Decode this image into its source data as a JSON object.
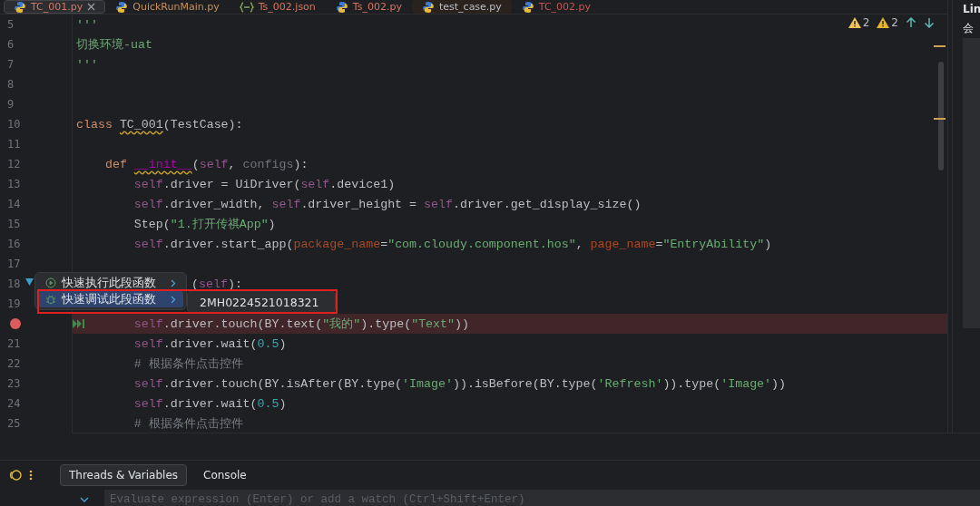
{
  "tabs": [
    {
      "label": "TC_001.py",
      "selected": true,
      "color": "#d5775f",
      "closable": true,
      "kind": "python"
    },
    {
      "label": "QuickRunMain.py",
      "selected": false,
      "color": "#c8905a",
      "closable": false,
      "kind": "python"
    },
    {
      "label": "Ts_002.json",
      "selected": false,
      "color": "#d5775f",
      "closable": false,
      "kind": "json"
    },
    {
      "label": "Ts_002.py",
      "selected": false,
      "color": "#d5775f",
      "closable": false,
      "kind": "python"
    },
    {
      "label": "test_case.py",
      "selected": false,
      "color": "#bcbec4",
      "closable": false,
      "kind": "python"
    },
    {
      "label": "TC_002.py",
      "selected": false,
      "color": "#c75450",
      "closable": false,
      "kind": "python"
    }
  ],
  "inspections": [
    {
      "kind": "warning",
      "count": "2"
    },
    {
      "kind": "weak-warning",
      "count": "2"
    }
  ],
  "lines": [
    {
      "number": "5",
      "breakpoint": false,
      "tokens": [
        {
          "text": "'''",
          "kind": "string"
        }
      ]
    },
    {
      "number": "6",
      "breakpoint": false,
      "tokens": [
        {
          "text": "切换环境-uat",
          "kind": "string"
        }
      ]
    },
    {
      "number": "7",
      "breakpoint": false,
      "tokens": [
        {
          "text": "'''",
          "kind": "string"
        }
      ]
    },
    {
      "number": "8",
      "breakpoint": false
    },
    {
      "number": "9",
      "breakpoint": false
    },
    {
      "number": "10",
      "breakpoint": false,
      "tokens": [
        {
          "text": "class ",
          "kind": "keyword"
        },
        {
          "text": "TC_001",
          "kind": "warned"
        },
        {
          "text": "(TestCase):",
          "kind": "plain"
        }
      ]
    },
    {
      "number": "11",
      "breakpoint": false
    },
    {
      "number": "12",
      "breakpoint": false,
      "tokens": [
        {
          "text": "    def ",
          "kind": "keyword"
        },
        {
          "text": "__init__",
          "kind": "magic"
        },
        {
          "text": "(",
          "kind": "plain"
        },
        {
          "text": "self",
          "kind": "self"
        },
        {
          "text": ", ",
          "kind": "plain"
        },
        {
          "text": "configs",
          "kind": "unused"
        },
        {
          "text": "):",
          "kind": "plain"
        }
      ]
    },
    {
      "number": "13",
      "breakpoint": false,
      "tokens": [
        {
          "text": "        self",
          "kind": "self"
        },
        {
          "text": ".driver = UiDriver(",
          "kind": "plain"
        },
        {
          "text": "self",
          "kind": "self"
        },
        {
          "text": ".device1)",
          "kind": "plain"
        }
      ]
    },
    {
      "number": "14",
      "breakpoint": false,
      "tokens": [
        {
          "text": "        self",
          "kind": "self"
        },
        {
          "text": ".driver_width, ",
          "kind": "plain"
        },
        {
          "text": "self",
          "kind": "self"
        },
        {
          "text": ".driver_height = ",
          "kind": "plain"
        },
        {
          "text": "self",
          "kind": "self"
        },
        {
          "text": ".driver.get_display_size()",
          "kind": "plain"
        }
      ]
    },
    {
      "number": "15",
      "breakpoint": false,
      "tokens": [
        {
          "text": "        Step(",
          "kind": "plain"
        },
        {
          "text": "\"1.打开传祺App\"",
          "kind": "string"
        },
        {
          "text": ")",
          "kind": "plain"
        }
      ]
    },
    {
      "number": "16",
      "breakpoint": false,
      "tokens": [
        {
          "text": "        self",
          "kind": "self"
        },
        {
          "text": ".driver.start_app(",
          "kind": "plain"
        },
        {
          "text": "package_name",
          "kind": "param"
        },
        {
          "text": "=",
          "kind": "plain"
        },
        {
          "text": "\"com.cloudy.component.hos\"",
          "kind": "string"
        },
        {
          "text": ", ",
          "kind": "plain"
        },
        {
          "text": "page_name",
          "kind": "param"
        },
        {
          "text": "=",
          "kind": "plain"
        },
        {
          "text": "\"EntryAbility\"",
          "kind": "string"
        },
        {
          "text": ")",
          "kind": "plain"
        }
      ]
    },
    {
      "number": "17",
      "breakpoint": false
    },
    {
      "number": "18",
      "breakpoint": false,
      "kind": "covered",
      "gutter_icon": true,
      "tokens": [
        {
          "text": "(",
          "kind": "plain"
        },
        {
          "text": "self",
          "kind": "self"
        },
        {
          "text": "):",
          "kind": "plain"
        }
      ]
    },
    {
      "number": "19",
      "breakpoint": false
    },
    {
      "breakpoint": true,
      "tokens": [
        {
          "text": "        self",
          "kind": "self"
        },
        {
          "text": ".driver.touch(BY.text(",
          "kind": "plain"
        },
        {
          "text": "\"我的\"",
          "kind": "string"
        },
        {
          "text": ").type(",
          "kind": "plain"
        },
        {
          "text": "\"Text\"",
          "kind": "string"
        },
        {
          "text": "))",
          "kind": "plain"
        }
      ]
    },
    {
      "number": "21",
      "breakpoint": false,
      "tokens": [
        {
          "text": "        self",
          "kind": "self"
        },
        {
          "text": ".driver.wait(",
          "kind": "plain"
        },
        {
          "text": "0.5",
          "kind": "number"
        },
        {
          "text": ")",
          "kind": "plain"
        }
      ]
    },
    {
      "number": "22",
      "breakpoint": false,
      "tokens": [
        {
          "text": "        # 根据条件点击控件",
          "kind": "comment"
        }
      ]
    },
    {
      "number": "23",
      "breakpoint": false,
      "tokens": [
        {
          "text": "        self",
          "kind": "self"
        },
        {
          "text": ".driver.touch(BY.isAfter(BY.type(",
          "kind": "plain"
        },
        {
          "text": "'Image'",
          "kind": "string"
        },
        {
          "text": ")).isBefore(BY.type(",
          "kind": "plain"
        },
        {
          "text": "'Refresh'",
          "kind": "string"
        },
        {
          "text": ")).type(",
          "kind": "plain"
        },
        {
          "text": "'Image'",
          "kind": "string"
        },
        {
          "text": "))",
          "kind": "plain"
        }
      ]
    },
    {
      "number": "24",
      "breakpoint": false,
      "tokens": [
        {
          "text": "        self",
          "kind": "self"
        },
        {
          "text": ".driver.wait(",
          "kind": "plain"
        },
        {
          "text": "0.5",
          "kind": "number"
        },
        {
          "text": ")",
          "kind": "plain"
        }
      ]
    },
    {
      "number": "25",
      "breakpoint": false,
      "tokens": [
        {
          "text": "        # 根据条件点击控件",
          "kind": "comment"
        }
      ]
    }
  ],
  "context_menu": {
    "items": [
      {
        "label": "快速执行此段函数",
        "kind": "run",
        "selected": false
      },
      {
        "label": "快速调试此段函数",
        "kind": "debug",
        "selected": true
      }
    ],
    "submenu": {
      "items": [
        "2MH0224521018321"
      ]
    }
  },
  "right_panel": {
    "title": "Lin",
    "tab": "会"
  },
  "debug_toolbar": {
    "tabs": [
      {
        "label": "Threads & Variables",
        "selected": true
      },
      {
        "label": "Console",
        "selected": false
      }
    ]
  },
  "evaluate_field": {
    "placeholder": "Evaluate expression (Enter) or add a watch (Ctrl+Shift+Enter)"
  }
}
